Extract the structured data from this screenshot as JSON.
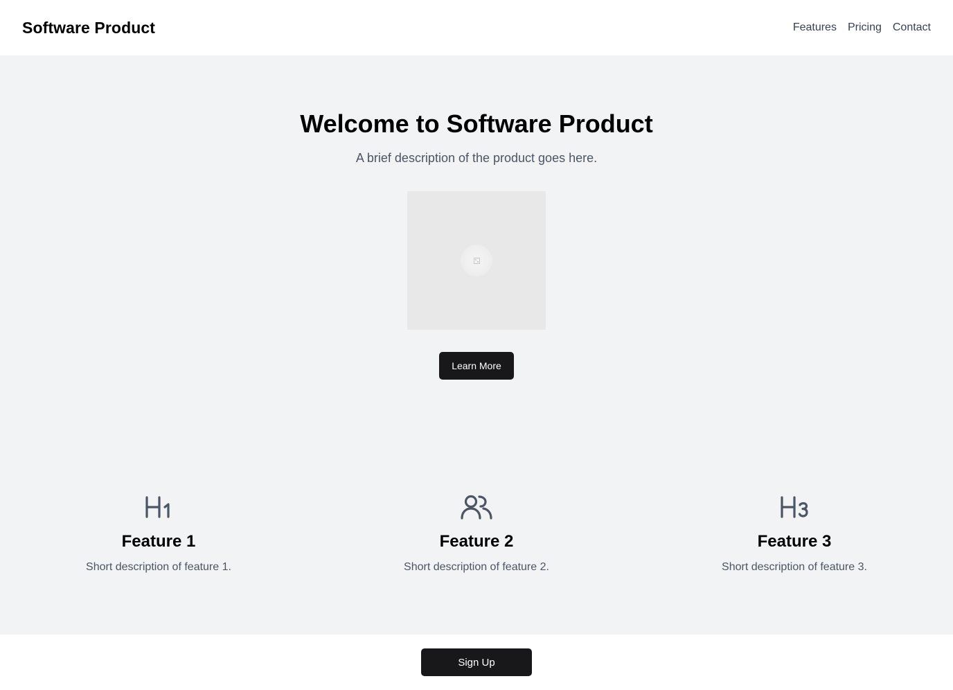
{
  "header": {
    "brand": "Software Product",
    "nav": [
      {
        "label": "Features"
      },
      {
        "label": "Pricing"
      },
      {
        "label": "Contact"
      }
    ]
  },
  "hero": {
    "title": "Welcome to Software Product",
    "description": "A brief description of the product goes here.",
    "image_icon": "image-placeholder-icon",
    "cta_label": "Learn More"
  },
  "features": [
    {
      "icon": "heading-1-icon",
      "title": "Feature 1",
      "description": "Short description of feature 1."
    },
    {
      "icon": "users-icon",
      "title": "Feature 2",
      "description": "Short description of feature 2."
    },
    {
      "icon": "heading-3-icon",
      "title": "Feature 3",
      "description": "Short description of feature 3."
    }
  ],
  "footer": {
    "cta_label": "Sign Up"
  },
  "colors": {
    "button": "#18181b",
    "background": "#f2f3f5",
    "icon": "#4b5563"
  }
}
